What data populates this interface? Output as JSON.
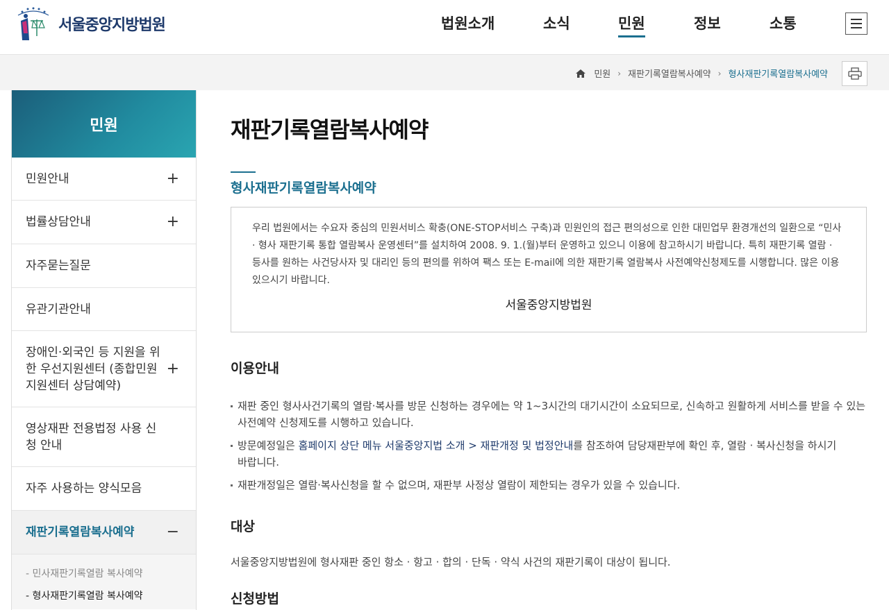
{
  "header": {
    "logo_text": "서울중앙지방법원",
    "nav": [
      {
        "label": "법원소개",
        "active": false
      },
      {
        "label": "소식",
        "active": false
      },
      {
        "label": "민원",
        "active": true
      },
      {
        "label": "정보",
        "active": false
      },
      {
        "label": "소통",
        "active": false
      }
    ],
    "menu_icon": "hamburger-icon"
  },
  "breadcrumb": {
    "home_icon": "home-icon",
    "items": [
      "민원",
      "재판기록열람복사예약",
      "형사재판기록열람복사예약"
    ],
    "print_icon": "printer-icon"
  },
  "sidebar": {
    "title": "민원",
    "items": [
      {
        "label": "민원안내",
        "toggle": "+"
      },
      {
        "label": "법률상담안내",
        "toggle": "+"
      },
      {
        "label": "자주묻는질문",
        "toggle": ""
      },
      {
        "label": "유관기관안내",
        "toggle": ""
      },
      {
        "label": "장애인·외국인 등 지원을 위한 우선지원센터 (종합민원지원센터 상담예약)",
        "toggle": "+"
      },
      {
        "label": "영상재판 전용법정 사용 신청 안내",
        "toggle": ""
      },
      {
        "label": "자주 사용하는 양식모음",
        "toggle": ""
      },
      {
        "label": "재판기록열람복사예약",
        "toggle": "−"
      }
    ],
    "sub_items": [
      {
        "label": "- 민사재판기록열람 복사예약",
        "on": false
      },
      {
        "label": "- 형사재판기록열람 복사예약",
        "on": true
      }
    ]
  },
  "content": {
    "title": "재판기록열람복사예약",
    "subtitle": "형사재판기록열람복사예약",
    "notice": "우리 법원에서는 수요자 중심의 민원서비스 확충(ONE-STOP서비스 구축)과 민원인의 접근 편의성으로 인한 대민업무 환경개선의 일환으로 “민사 · 형사 재판기록 통합 열람복사 운영센터”를 설치하여 2008. 9. 1.(월)부터 운영하고 있으니 이용에 참고하시기 바랍니다. 특히 재판기록 열람 · 등사를 원하는 사건당사자 및 대리인 등의 편의를 위하여 팩스 또는 E-mail에 의한 재판기록 열람복사 사전예약신청제도를 시행합니다. 많은 이용 있으시기 바랍니다.",
    "notice_sign": "서울중앙지방법원",
    "usage_heading": "이용안내",
    "usage": {
      "item1": "재판 중인 형사사건기록의 열람·복사를 방문 신청하는 경우에는 약 1~3시간의 대기시간이 소요되므로, 신속하고 원활하게 서비스를 받을 수 있는 사전예약 신청제도를 시행하고 있습니다.",
      "item2_before": "방문예정일은 ",
      "item2_link": "홈페이지 상단 메뉴 서울중앙지법 소개 > 재판개정 및 법정안내",
      "item2_after": "를 참조하여 담당재판부에 확인 후, 열람 · 복사신청을 하시기 바랍니다.",
      "item3": "재판개정일은 열람·복사신청을 할 수 없으며, 재판부 사정상 열람이 제한되는 경우가 있을 수 있습니다."
    },
    "target_heading": "대상",
    "target_text": "서울중앙지방법원에 형사재판 중인 항소 · 항고 · 합의 · 단독 · 약식 사건의 재판기록이 대상이 됩니다.",
    "method_heading": "신청방법"
  }
}
